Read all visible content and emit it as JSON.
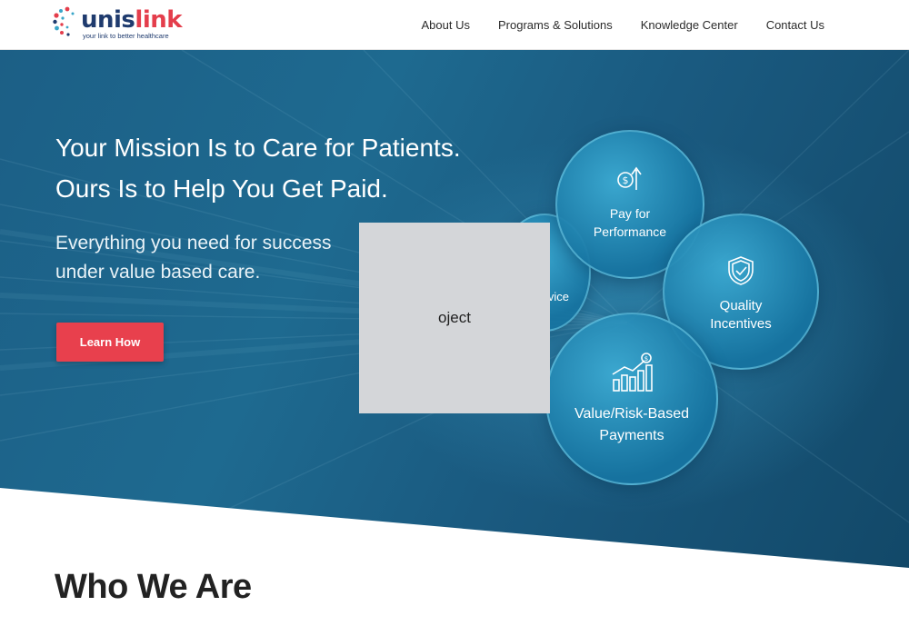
{
  "logo": {
    "word_a": "unis",
    "word_b": "link",
    "tagline": "your link to better healthcare"
  },
  "nav": {
    "items": [
      "About Us",
      "Programs & Solutions",
      "Knowledge Center",
      "Contact Us"
    ]
  },
  "hero": {
    "title_line1": "Your Mission Is to Care for Patients.",
    "title_line2": "Ours Is to Help You Get Paid.",
    "subtitle_line1": "Everything you need for success",
    "subtitle_line2": "under value based care.",
    "cta_label": "Learn How"
  },
  "circles": {
    "pay": {
      "line1": "Pay for",
      "line2": "Performance",
      "icon": "dollar-arrow-up-icon"
    },
    "quality": {
      "line1": "Quality",
      "line2": "Incentives",
      "icon": "shield-check-icon"
    },
    "value": {
      "line1": "Value/Risk-Based",
      "line2": "Payments",
      "icon": "bar-chart-dollar-icon"
    },
    "service": {
      "partial_label": "vice"
    }
  },
  "placeholder": {
    "label": "oject"
  },
  "section": {
    "heading": "Who We Are"
  },
  "colors": {
    "accent": "#e8404d",
    "brand_navy": "#1f3b6e",
    "hero_blue": "#1e6a90"
  }
}
